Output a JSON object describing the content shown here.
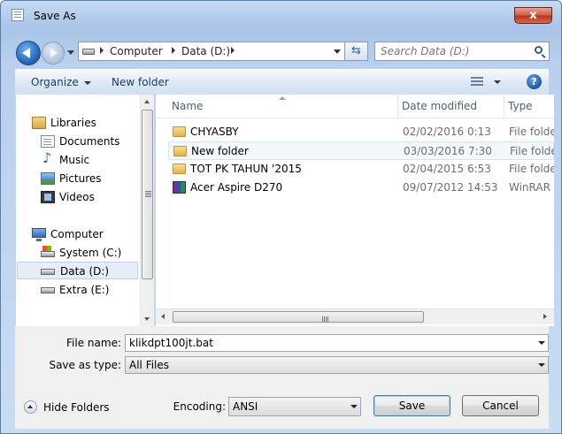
{
  "window": {
    "title": "Save As",
    "close_label": "x"
  },
  "address": {
    "crumbs": [
      "Computer",
      "Data (D:)"
    ],
    "search_placeholder": "Search Data (D:)"
  },
  "toolbar": {
    "organize_label": "Organize",
    "new_folder_label": "New folder",
    "help_label": "?"
  },
  "nav": {
    "items": [
      {
        "label": "Libraries",
        "icon": "libraries-icon"
      },
      {
        "label": "Documents",
        "icon": "documents-icon"
      },
      {
        "label": "Music",
        "icon": "music-icon"
      },
      {
        "label": "Pictures",
        "icon": "pictures-icon"
      },
      {
        "label": "Videos",
        "icon": "videos-icon"
      },
      {
        "label": "Computer",
        "icon": "computer-icon"
      },
      {
        "label": "System (C:)",
        "icon": "system-drive-icon"
      },
      {
        "label": "Data (D:)",
        "icon": "drive-icon",
        "selected": true
      },
      {
        "label": "Extra (E:)",
        "icon": "drive-icon"
      }
    ]
  },
  "files": {
    "columns": [
      "Name",
      "Date modified",
      "Type"
    ],
    "rows": [
      {
        "name": "CHYASBY",
        "date": "02/02/2016 0:13",
        "type": "File folder",
        "icon": "folder-icon"
      },
      {
        "name": "New folder",
        "date": "03/03/2016 7:30",
        "type": "File folder",
        "icon": "folder-icon"
      },
      {
        "name": "TOT PK TAHUN '2015",
        "date": "02/04/2015 6:53",
        "type": "File folder",
        "icon": "folder-icon"
      },
      {
        "name": "Acer Aspire D270",
        "date": "09/07/2012 14:53",
        "type": "WinRAR a",
        "icon": "winrar-archive-icon"
      }
    ]
  },
  "form": {
    "file_name_label": "File name:",
    "file_name_value": "klikdpt100jt.bat",
    "save_as_type_label": "Save as type:",
    "save_as_type_value": "All Files",
    "encoding_label": "Encoding:",
    "encoding_value": "ANSI",
    "save_label": "Save",
    "cancel_label": "Cancel",
    "hide_folders_label": "Hide Folders"
  }
}
